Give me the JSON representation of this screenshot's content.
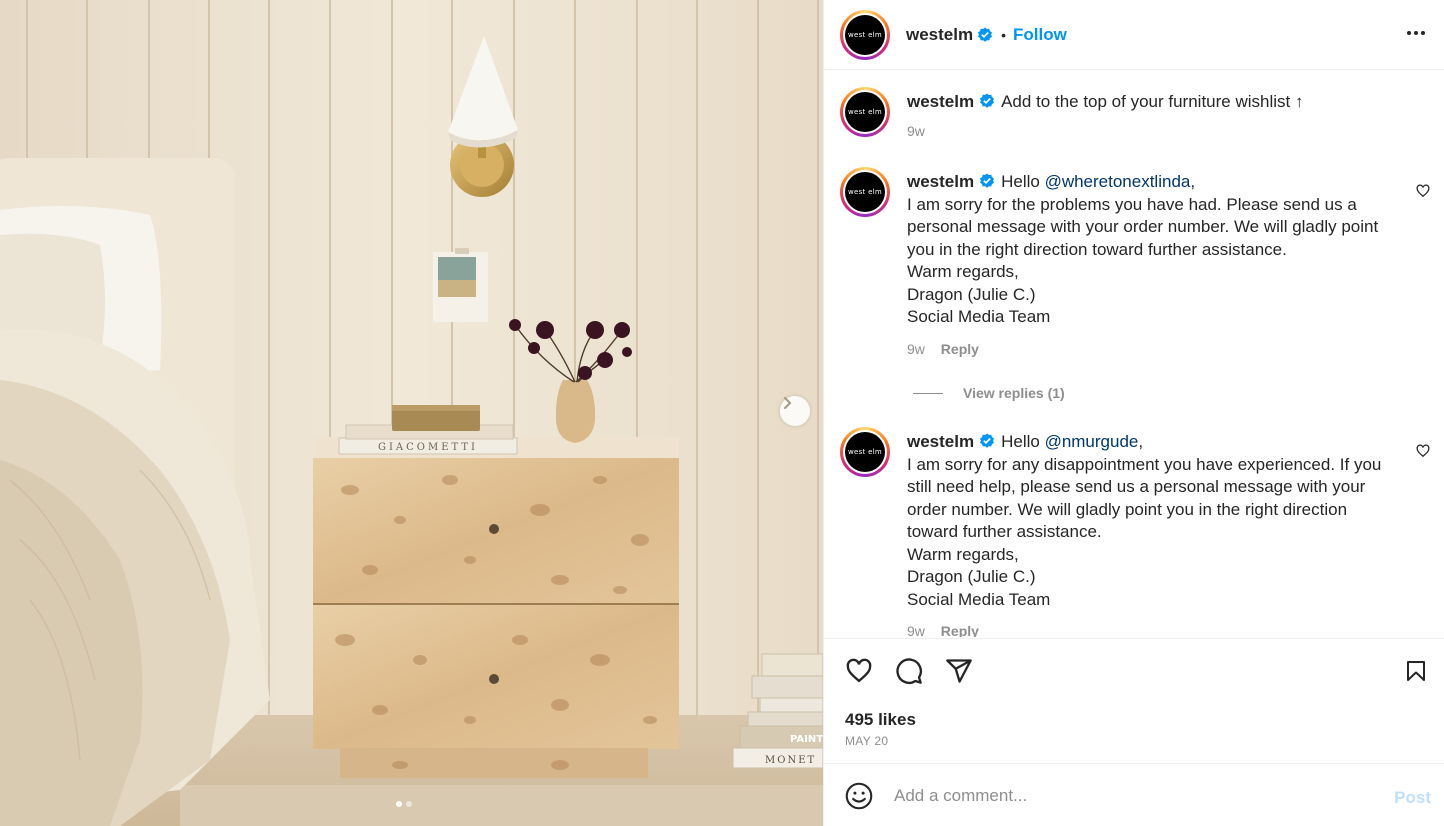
{
  "media": {
    "book_spine_text": "GIACOMETTI",
    "book_stack_text_1": "PAINTIN",
    "book_stack_text_2": "MONET",
    "carousel_total": 2,
    "carousel_active": 1
  },
  "header": {
    "avatar_text": "west elm",
    "username": "westelm",
    "separator": "•",
    "follow_label": "Follow"
  },
  "caption": {
    "avatar_text": "west elm",
    "username": "westelm",
    "text": "Add to the top of your furniture wishlist ↑",
    "time": "9w"
  },
  "comments": [
    {
      "avatar_text": "west elm",
      "username": "westelm",
      "greeting": "Hello ",
      "mention": "@wheretonextlinda",
      "after_mention": ",",
      "line1": "I am sorry for the problems you have had. Please send us a",
      "line2": "personal message with your order number. We will gladly point",
      "line3": "you in the right direction toward further assistance.",
      "line4": "Warm regards,",
      "line5": "Dragon (Julie C.)",
      "line6": "Social Media Team",
      "time": "9w",
      "reply_label": "Reply",
      "view_replies": "View replies (1)"
    },
    {
      "avatar_text": "west elm",
      "username": "westelm",
      "greeting": "Hello ",
      "mention": "@nmurgude",
      "after_mention": ",",
      "line1": "I am sorry for any disappointment you have experienced. If you",
      "line2": "still need help, please send us a personal message with your",
      "line3": "order number. We will gladly point you in the right direction",
      "line4": "toward further assistance.",
      "line5": "Warm regards,",
      "line6": "Dragon (Julie C.)",
      "line7": "Social Media Team",
      "time": "9w",
      "reply_label": "Reply"
    }
  ],
  "actions": {
    "likes": "495 likes",
    "date": "MAY 20"
  },
  "comment_box": {
    "placeholder": "Add a comment...",
    "post_label": "Post"
  },
  "colors": {
    "accent": "#0095f6",
    "verified": "#0095f6",
    "muted": "#8e8e8e",
    "post_disabled": "#c0dffd"
  }
}
